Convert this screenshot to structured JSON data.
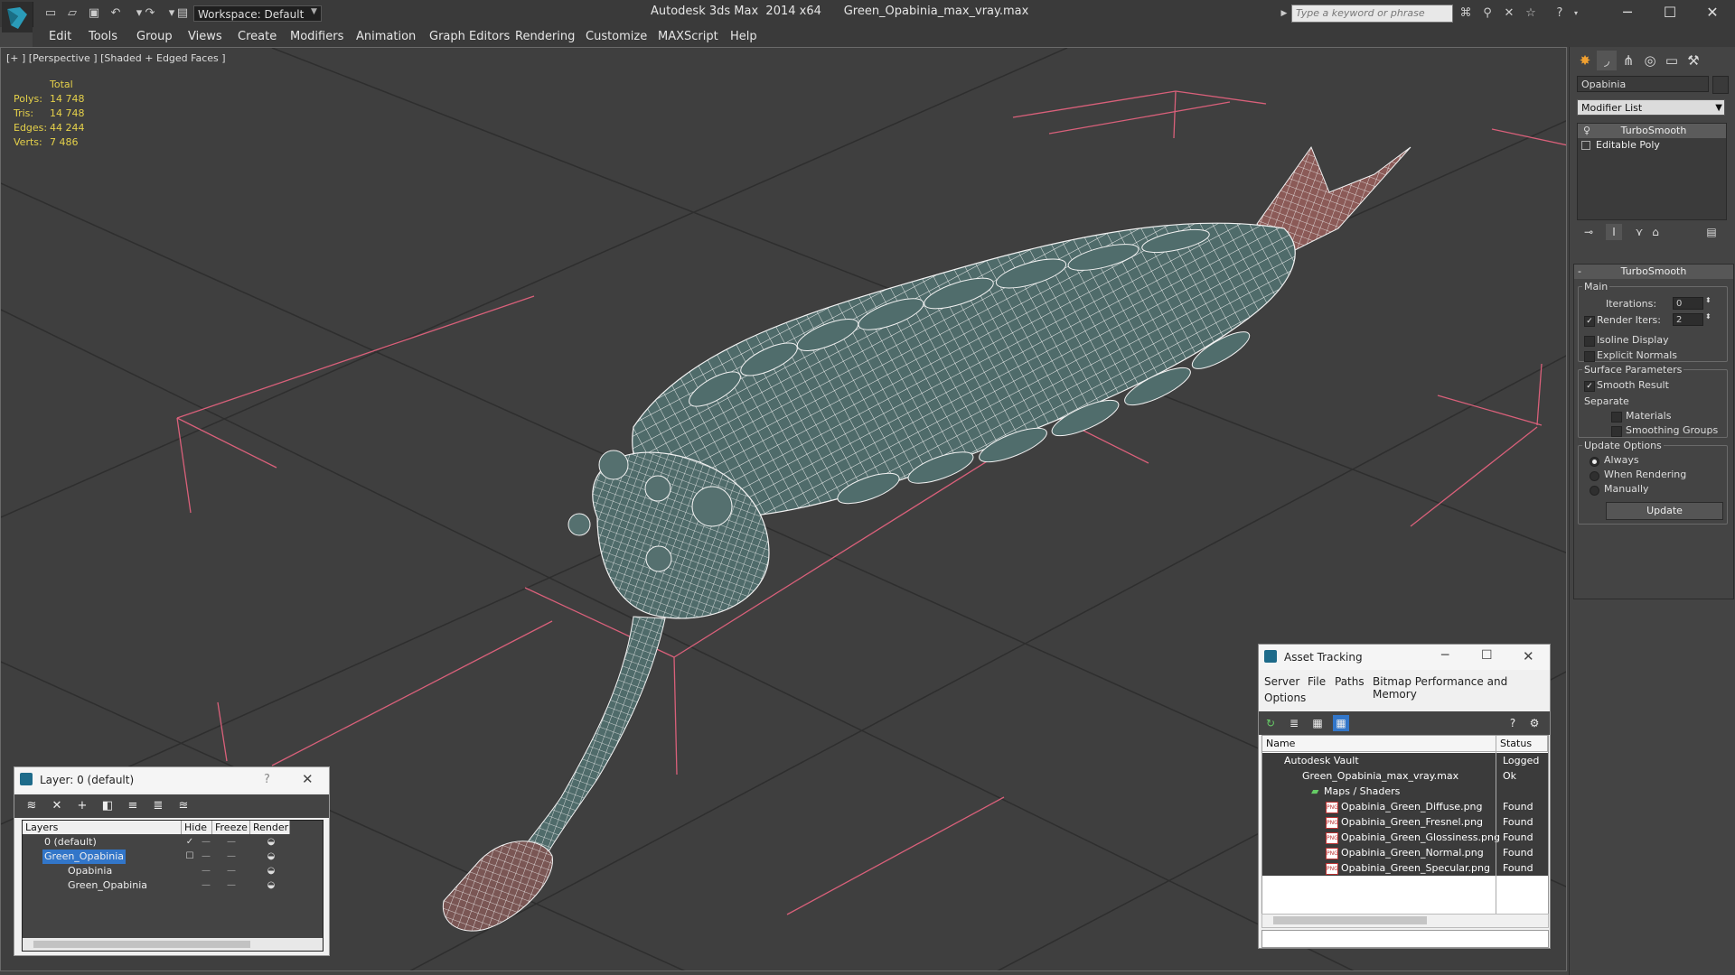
{
  "titlebar": {
    "workspace": "Workspace: Default",
    "app_name": "Autodesk 3ds Max  2014 x64",
    "file_name": "Green_Opabinia_max_vray.max",
    "search_placeholder": "Type a keyword or phrase"
  },
  "menu": [
    "Edit",
    "Tools",
    "Group",
    "Views",
    "Create",
    "Modifiers",
    "Animation",
    "Graph Editors",
    "Rendering",
    "Customize",
    "MAXScript",
    "Help"
  ],
  "viewport": {
    "label": "[+ ] [Perspective ] [Shaded + Edged Faces ]",
    "stats": {
      "header": "Total",
      "rows": [
        {
          "k": "Polys:",
          "v": "14 748"
        },
        {
          "k": "Tris:",
          "v": "14 748"
        },
        {
          "k": "Edges:",
          "v": "44 244"
        },
        {
          "k": "Verts:",
          "v": "7 486"
        }
      ]
    }
  },
  "command_panel": {
    "object_name": "Opabinia",
    "modifier_list": "Modifier List",
    "stack": [
      "TurboSmooth",
      "Editable Poly"
    ],
    "rollout_title": "TurboSmooth",
    "main_group": "Main",
    "iterations_label": "Iterations:",
    "iterations_value": "0",
    "render_iters_label": "Render Iters:",
    "render_iters_value": "2",
    "isoline_label": "Isoline Display",
    "explicit_normals_label": "Explicit Normals",
    "surface_group": "Surface Parameters",
    "smooth_result_label": "Smooth Result",
    "separate_label": "Separate",
    "materials_label": "Materials",
    "smoothing_groups_label": "Smoothing Groups",
    "update_group": "Update Options",
    "always_label": "Always",
    "when_rendering_label": "When Rendering",
    "manually_label": "Manually",
    "update_button": "Update"
  },
  "layer_dialog": {
    "title": "Layer: 0 (default)",
    "help": "?",
    "columns": [
      "Layers",
      "Hide",
      "Freeze",
      "Render"
    ],
    "rows": [
      "0 (default)",
      "Green_Opabinia",
      "Opabinia",
      "Green_Opabinia"
    ]
  },
  "asset_dialog": {
    "title": "Asset Tracking",
    "menus": [
      "Server",
      "File",
      "Paths",
      "Bitmap Performance and Memory",
      "Options"
    ],
    "columns": [
      "Name",
      "Status"
    ],
    "rows": [
      {
        "name": "Autodesk Vault",
        "status": "Logged O"
      },
      {
        "name": "Green_Opabinia_max_vray.max",
        "status": "Ok"
      },
      {
        "name": "Maps / Shaders",
        "status": ""
      },
      {
        "name": "Opabinia_Green_Diffuse.png",
        "status": "Found"
      },
      {
        "name": "Opabinia_Green_Fresnel.png",
        "status": "Found"
      },
      {
        "name": "Opabinia_Green_Glossiness.png",
        "status": "Found"
      },
      {
        "name": "Opabinia_Green_Normal.png",
        "status": "Found"
      },
      {
        "name": "Opabinia_Green_Specular.png",
        "status": "Found"
      }
    ]
  },
  "colors": {
    "viewport_bg": "#3f3f3f",
    "grid_line": "#2e2e2e",
    "gizmo_pink": "#d9607a",
    "stats_yellow": "#e5d14a",
    "model_fill": "#4f6b6a",
    "wire": "#f2f2f2",
    "selection_blue": "#3276c9"
  }
}
